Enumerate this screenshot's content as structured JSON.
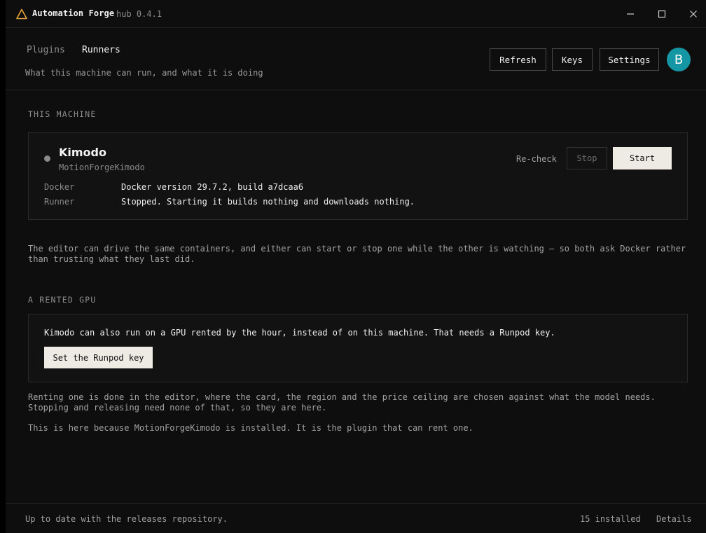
{
  "window": {
    "title": "Automation Forge",
    "version": "hub 0.4.1",
    "logo_icon": "triangle-logo-icon",
    "controls": [
      "minimize-icon",
      "maximize-icon",
      "close-icon"
    ]
  },
  "header": {
    "tabs": [
      {
        "label": "Plugins",
        "active": false
      },
      {
        "label": "Runners",
        "active": true
      }
    ],
    "subtitle": "What this machine can run, and what it is doing",
    "buttons": {
      "refresh": "Refresh",
      "keys": "Keys",
      "settings": "Settings"
    },
    "avatar_initial": "B",
    "avatar_color": "#1496a4"
  },
  "machine": {
    "section_label": "THIS MACHINE",
    "runner": {
      "name": "Kimodo",
      "plugin": "MotionForgeKimodo",
      "status_color": "#8a8a8a",
      "recheck_label": "Re-check",
      "stop_label": "Stop",
      "start_label": "Start",
      "details": [
        {
          "key": "Docker",
          "value": "Docker version 29.7.2, build a7dcaa6"
        },
        {
          "key": "Runner",
          "value": "Stopped. Starting it builds nothing and downloads nothing."
        }
      ]
    },
    "note": "The editor can drive the same containers, and either can start or stop one while the other is watching — so both ask Docker rather than trusting what they last did."
  },
  "gpu": {
    "section_label": "A RENTED GPU",
    "text": "Kimodo can also run on a GPU rented by the hour, instead of on this machine. That needs a Runpod key.",
    "button_label": "Set the Runpod key",
    "note1": "Renting one is done in the editor, where the card, the region and the price ceiling are chosen against what the model needs. Stopping and releasing need none of that, so they are here.",
    "note2": "This is here because MotionForgeKimodo is installed. It is the plugin that can rent one."
  },
  "footer": {
    "status": "Up to date with the releases repository.",
    "installed": "15 installed",
    "details": "Details"
  }
}
